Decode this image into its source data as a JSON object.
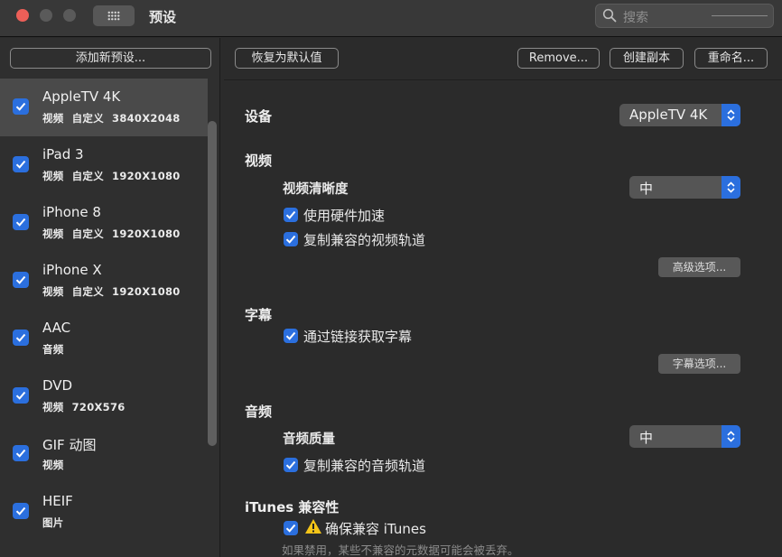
{
  "window": {
    "title": "预设"
  },
  "search": {
    "placeholder": "搜索"
  },
  "sidebar": {
    "add_label": "添加新预设...",
    "presets": [
      {
        "name": "AppleTV 4K",
        "meta": [
          "视频",
          "自定义",
          "3840X2048"
        ],
        "checked": true,
        "selected": true
      },
      {
        "name": "iPad 3",
        "meta": [
          "视频",
          "自定义",
          "1920X1080"
        ],
        "checked": true
      },
      {
        "name": "iPhone 8",
        "meta": [
          "视频",
          "自定义",
          "1920X1080"
        ],
        "checked": true
      },
      {
        "name": "iPhone X",
        "meta": [
          "视频",
          "自定义",
          "1920X1080"
        ],
        "checked": true
      },
      {
        "name": "AAC",
        "meta": [
          "音频"
        ],
        "checked": true
      },
      {
        "name": "DVD",
        "meta": [
          "视频",
          "720X576"
        ],
        "checked": true
      },
      {
        "name": "GIF 动图",
        "meta": [
          "视频"
        ],
        "checked": true
      },
      {
        "name": "HEIF",
        "meta": [
          "图片"
        ],
        "checked": true
      }
    ]
  },
  "toolbar": {
    "restore_label": "恢复为默认值",
    "remove_label": "Remove...",
    "duplicate_label": "创建副本",
    "rename_label": "重命名..."
  },
  "main": {
    "device": {
      "label": "设备",
      "value": "AppleTV 4K"
    },
    "video": {
      "section": "视频",
      "quality_label": "视频清晰度",
      "quality_value": "中",
      "hw_accel": "使用硬件加速",
      "copy_video": "复制兼容的视频轨道",
      "advanced": "高级选项..."
    },
    "subtitles": {
      "section": "字幕",
      "fetch": "通过链接获取字幕",
      "options": "字幕选项..."
    },
    "audio": {
      "section": "音频",
      "quality_label": "音频质量",
      "quality_value": "中",
      "copy_audio": "复制兼容的音频轨道"
    },
    "itunes": {
      "section": "iTunes 兼容性",
      "ensure": "确保兼容 iTunes",
      "note": "如果禁用，某些不兼容的元数据可能会被丢弃。"
    }
  },
  "colors": {
    "accent": "#2b6fde",
    "warning": "#f5c518",
    "close": "#ec5f58"
  }
}
